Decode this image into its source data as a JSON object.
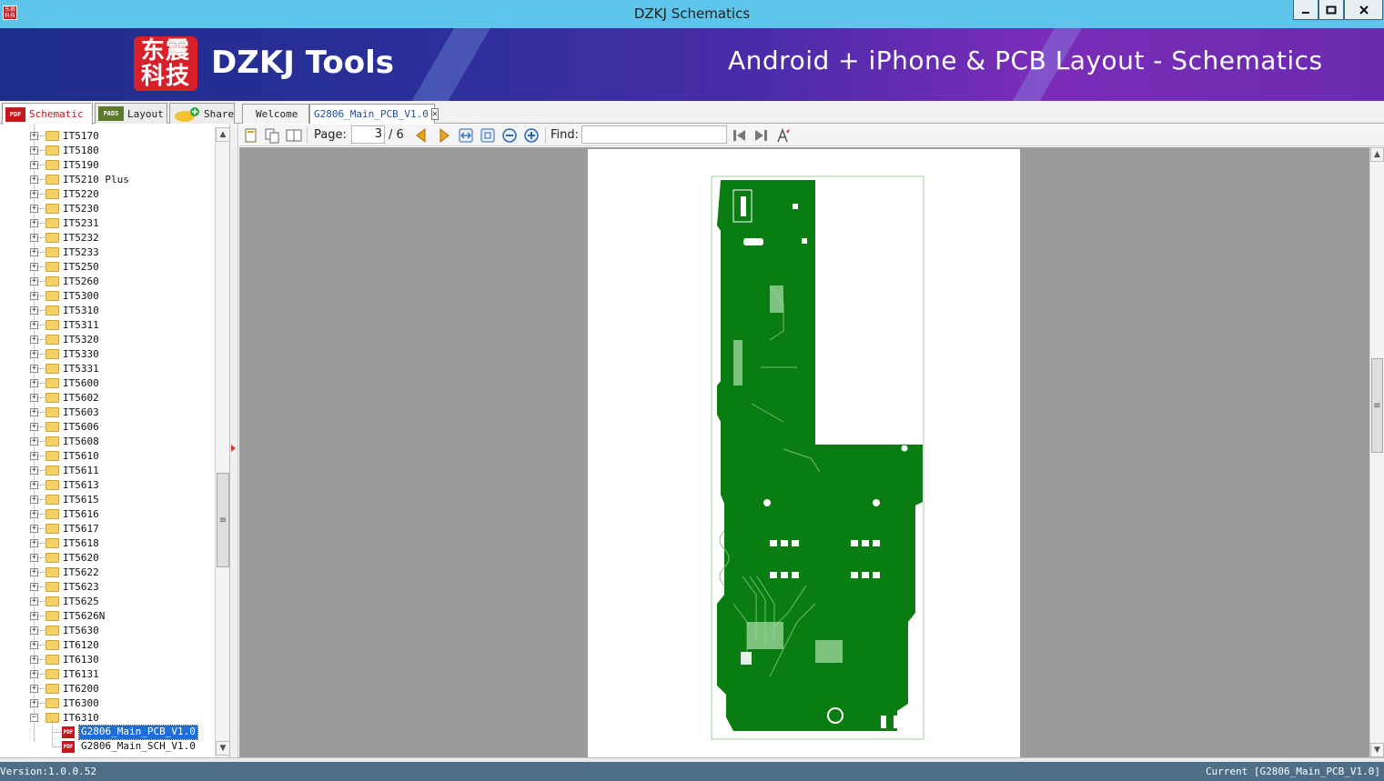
{
  "window": {
    "title": "DZKJ Schematics",
    "app_icon_text": "东震科技"
  },
  "banner": {
    "logo_text": "东震科技",
    "brand": "DZKJ Tools",
    "tagline": "Android + iPhone & PCB Layout - Schematics"
  },
  "side_tabs": [
    {
      "label": "Schematic",
      "icon": "pdf-icon",
      "active": true
    },
    {
      "label": "Layout",
      "icon": "pads-icon",
      "active": false
    },
    {
      "label": "Share",
      "icon": "cloud-share-icon",
      "active": false
    }
  ],
  "side_tab_icons": {
    "pdf": "PDF",
    "pads": "PADS"
  },
  "doc_tabs": [
    {
      "label": "Welcome",
      "active": false,
      "closable": false
    },
    {
      "label": "G2806_Main_PCB_V1.0",
      "active": true,
      "closable": true
    }
  ],
  "tree": {
    "folders": [
      "IT5170",
      "IT5180",
      "IT5190",
      "IT5210 Plus",
      "IT5220",
      "IT5230",
      "IT5231",
      "IT5232",
      "IT5233",
      "IT5250",
      "IT5260",
      "IT5300",
      "IT5310",
      "IT5311",
      "IT5320",
      "IT5330",
      "IT5331",
      "IT5600",
      "IT5602",
      "IT5603",
      "IT5606",
      "IT5608",
      "IT5610",
      "IT5611",
      "IT5613",
      "IT5615",
      "IT5616",
      "IT5617",
      "IT5618",
      "IT5620",
      "IT5622",
      "IT5623",
      "IT5625",
      "IT5626N",
      "IT5630",
      "IT6120",
      "IT6130",
      "IT6131",
      "IT6200",
      "IT6300"
    ],
    "expanded_folder": "IT6310",
    "files": [
      {
        "label": "G2806_Main_PCB_V1.0",
        "selected": true
      },
      {
        "label": "G2806_Main_SCH_V1.0",
        "selected": false
      }
    ]
  },
  "toolbar": {
    "page_label": "Page:",
    "current_page": "3",
    "total_pages": "/ 6",
    "find_label": "Find:",
    "find_value": ""
  },
  "status": {
    "version": "Version:1.0.0.52",
    "current": "Current [G2806_Main_PCB_V1.0]"
  },
  "colors": {
    "titlebar": "#5fc4ea",
    "pcb_green": "#0a7d12",
    "selection": "#1d6fd7",
    "statusbar": "#4f6e88"
  }
}
